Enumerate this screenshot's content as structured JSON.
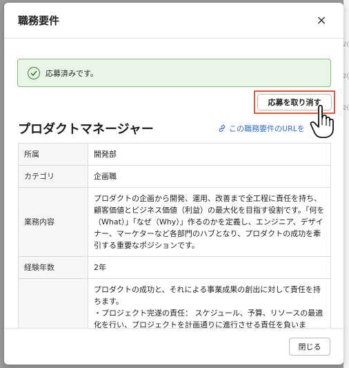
{
  "background": {
    "peek_chars": [
      "2(",
      "2(",
      "2("
    ]
  },
  "modal": {
    "title": "職務要件",
    "close_symbol": "×"
  },
  "alert": {
    "text": "応募済みです。",
    "color_bg": "#e9f6e7",
    "color_border": "#79c26f"
  },
  "actions": {
    "cancel_label": "応募を取り消す",
    "highlight_color": "#e2553e"
  },
  "job": {
    "title": "プロダクトマネージャー",
    "url_link_label": "この職務要件のURLを"
  },
  "details": [
    {
      "label": "所属",
      "value": "開発部"
    },
    {
      "label": "カテゴリ",
      "value": "企画職"
    },
    {
      "label": "業務内容",
      "value": "プロダクトの企画から開発、運用、改善まで全工程に責任を持ち、顧客価値とビジネス価値（利益）の最大化を目指す役割です。「何を（What）」「なぜ（Why）」作るのかを定義し、エンジニア、デザイナー、マーケターなど各部門のハブとなり、プロダクトの成功を牽引する重要なポジションです。"
    },
    {
      "label": "経験年数",
      "value": "2年"
    },
    {
      "label": "",
      "value": "プロダクトの成功と、それによる事業成果の創出に対して責任を持ちます。\n・プロジェクト完遂の責任： スケジュール、予算、リソースの最適化を行い、プロジェクトを計画通りに進行させる責任を負いま"
    }
  ],
  "footer": {
    "close_label": "閉じる"
  }
}
